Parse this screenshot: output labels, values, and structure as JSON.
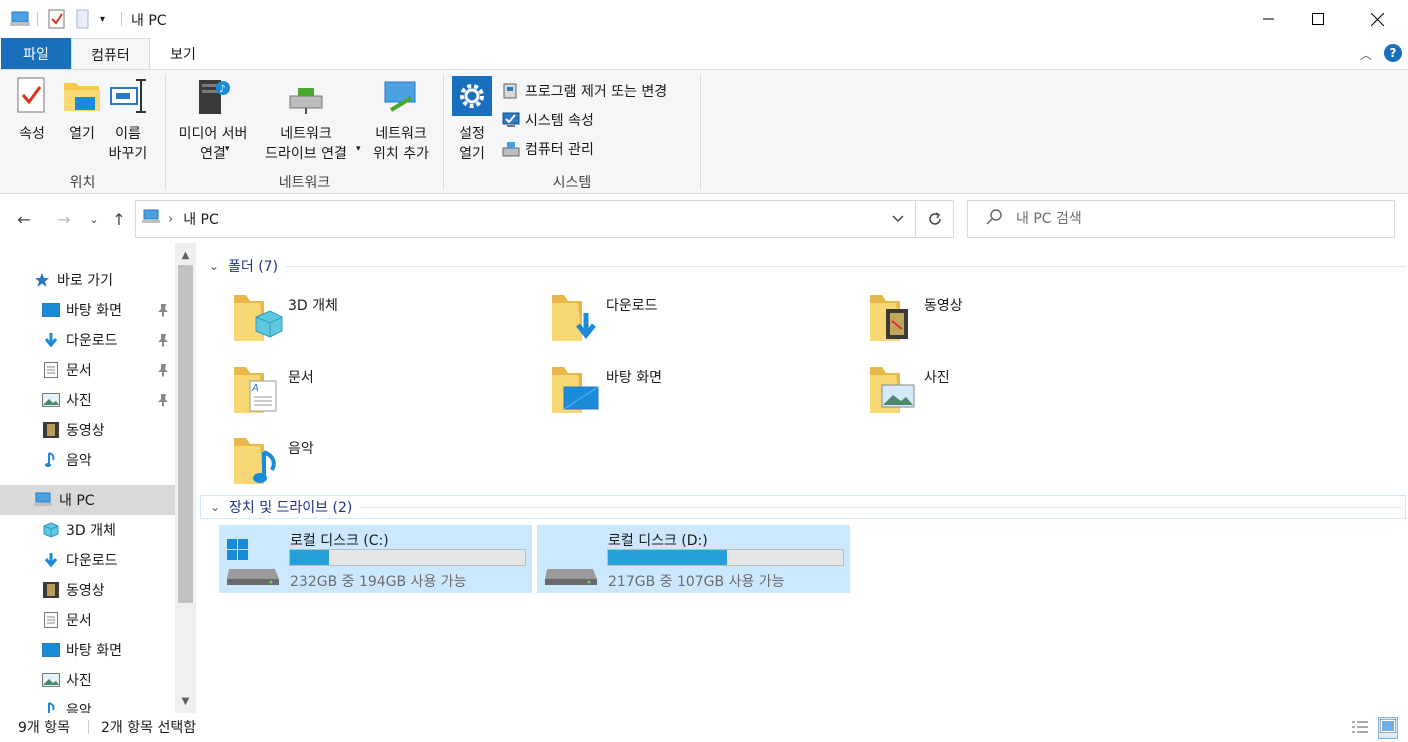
{
  "window": {
    "title": "내 PC"
  },
  "ribbon_tabs": {
    "file": "파일",
    "computer": "컴퓨터",
    "view": "보기"
  },
  "ribbon": {
    "location_group": "위치",
    "network_group": "네트워크",
    "system_group": "시스템",
    "properties": "속성",
    "open": "열기",
    "rename": "이름\n바꾸기",
    "media_server": "미디어 서버\n연결",
    "map_network_drive": "네트워크\n드라이브 연결",
    "add_network_location": "네트워크\n위치 추가",
    "open_settings": "설정\n열기",
    "uninstall": "프로그램 제거 또는 변경",
    "system_properties": "시스템 속성",
    "manage": "컴퓨터 관리"
  },
  "address": {
    "path": "내 PC",
    "search_placeholder": "내 PC 검색"
  },
  "nav": {
    "quick_access": "바로 가기",
    "quick_items": [
      "바탕 화면",
      "다운로드",
      "문서",
      "사진",
      "동영상",
      "음악"
    ],
    "this_pc": "내 PC",
    "pc_items": [
      "3D 개체",
      "다운로드",
      "동영상",
      "문서",
      "바탕 화면",
      "사진",
      "음악"
    ]
  },
  "content": {
    "folders_header": "폴더 (7)",
    "folders": [
      "3D 개체",
      "다운로드",
      "동영상",
      "문서",
      "바탕 화면",
      "사진",
      "음악"
    ],
    "drives_header": "장치 및 드라이브 (2)",
    "drives": [
      {
        "name": "로컬 디스크 (C:)",
        "info": "232GB 중 194GB 사용 가능",
        "used_fraction": 0.164
      },
      {
        "name": "로컬 디스크 (D:)",
        "info": "217GB 중 107GB 사용 가능",
        "used_fraction": 0.507
      }
    ]
  },
  "status": {
    "count": "9개 항목",
    "selected": "2개 항목 선택함"
  },
  "colors": {
    "accent": "#1a6fbd",
    "selection": "#cce8ff",
    "drive_bar": "#26a0da",
    "folder": "#f8d775"
  }
}
